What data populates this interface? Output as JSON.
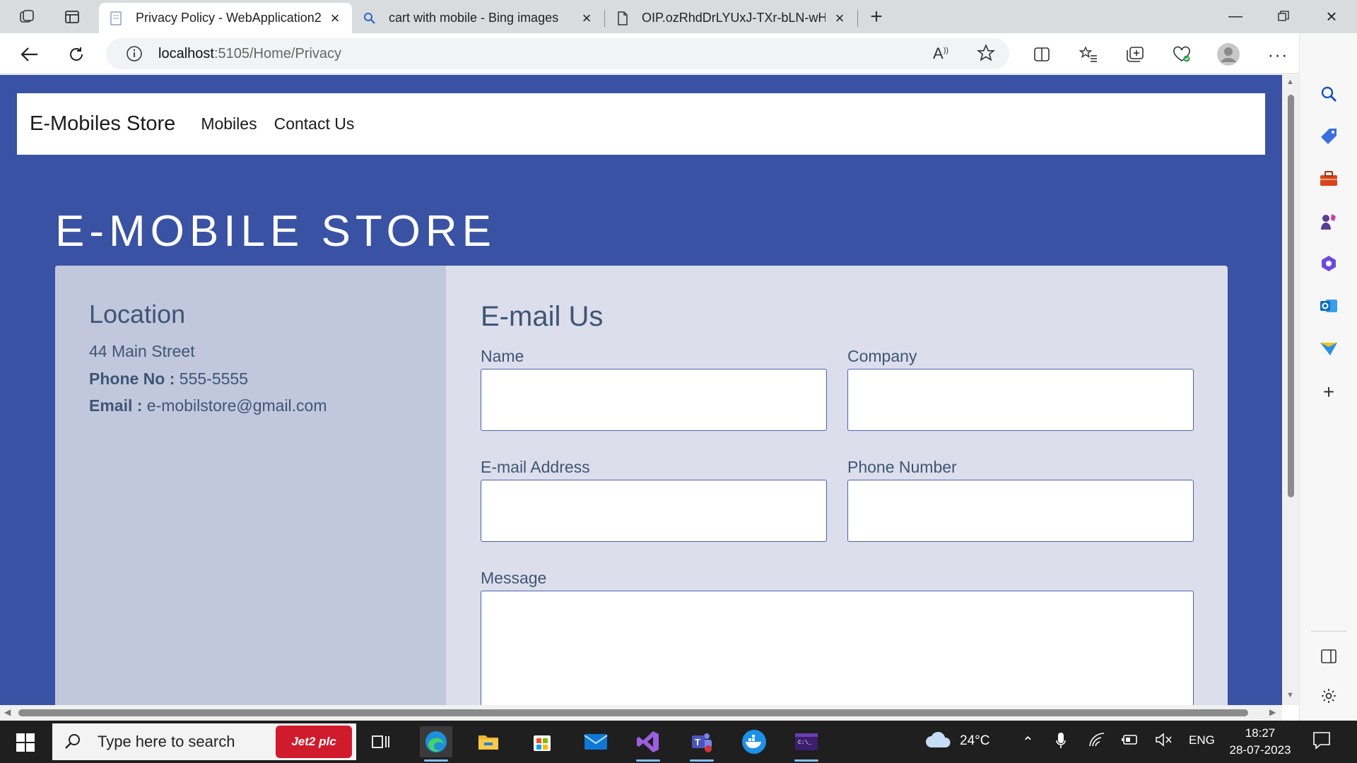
{
  "browser": {
    "tabs": [
      {
        "title": "Privacy Policy - WebApplication2",
        "active": true
      },
      {
        "title": "cart with mobile - Bing images",
        "active": false
      },
      {
        "title": "OIP.ozRhdDrLYUxJ-TXr-bLN-wHa",
        "active": false
      }
    ],
    "address": {
      "host": "localhost",
      "path": ":5105/Home/Privacy"
    }
  },
  "site": {
    "brand": "E-Mobiles Store",
    "nav": [
      "Mobiles",
      "Contact Us"
    ],
    "hero_title": "E-MOBILE STORE"
  },
  "location": {
    "heading": "Location",
    "address": "44 Main Street",
    "phone_label": "Phone No :",
    "phone_value": " 555-5555",
    "email_label": "Email :",
    "email_value": " e-mobilstore@gmail.com"
  },
  "email_form": {
    "heading": "E-mail Us",
    "name_label": "Name",
    "company_label": "Company",
    "email_label": "E-mail Address",
    "phone_label": "Phone Number",
    "message_label": "Message"
  },
  "taskbar": {
    "search_placeholder": "Type here to search",
    "promo": "Jet2 plc",
    "weather": "24°C",
    "language": "ENG",
    "time": "18:27",
    "date": "28-07-2023"
  },
  "colors": {
    "page_background": "#3a52a3",
    "card_background": "#dcdfeb",
    "location_panel": "#c1c7dc",
    "text_accent": "#3f5577"
  }
}
